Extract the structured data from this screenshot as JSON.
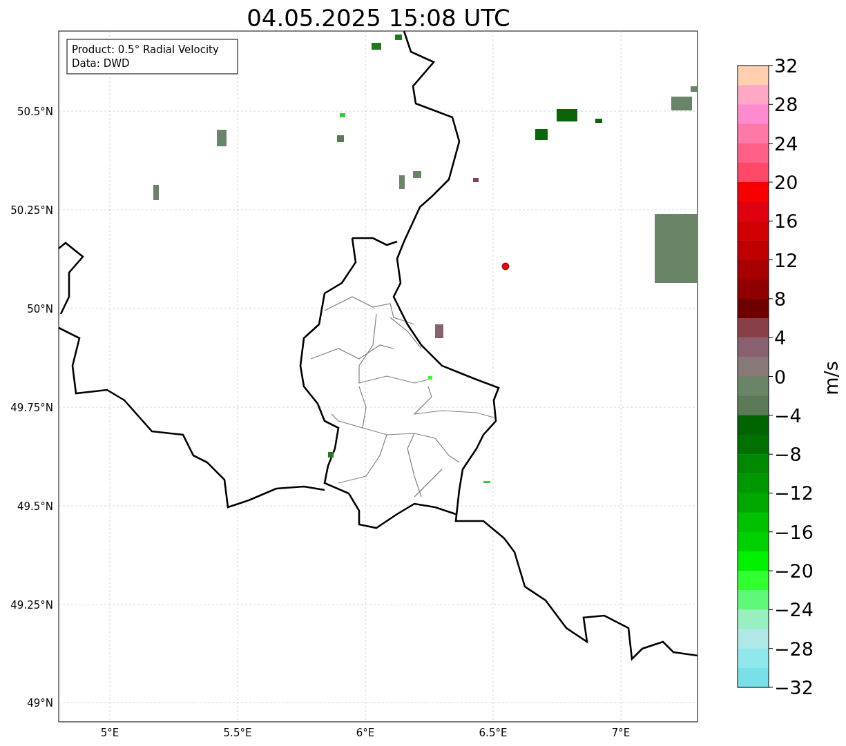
{
  "title": "04.05.2025 15:08 UTC",
  "info_box": [
    "Product: 0.5° Radial Velocity",
    "Data: DWD"
  ],
  "lat_labels": [
    "50.5°N",
    "50.25°N",
    "50°N",
    "49.75°N",
    "49.5°N",
    "49.25°N",
    "49°N"
  ],
  "lon_labels": [
    "5°E",
    "5.5°E",
    "6°E",
    "6.5°E",
    "7°E"
  ],
  "colorbar": {
    "label": "m/s",
    "ticks": [
      "32",
      "28",
      "24",
      "20",
      "16",
      "12",
      "8",
      "4",
      "0",
      "−4",
      "−8",
      "−12",
      "−16",
      "−20",
      "−24",
      "−28",
      "−32"
    ],
    "bands": [
      {
        "color": "#ffcfaf"
      },
      {
        "color": "#ffa8c4"
      },
      {
        "color": "#ff8ad0"
      },
      {
        "color": "#ff78a8"
      },
      {
        "color": "#ff6088"
      },
      {
        "color": "#ff4868"
      },
      {
        "color": "#f80000"
      },
      {
        "color": "#e00010"
      },
      {
        "color": "#d00000"
      },
      {
        "color": "#c00000"
      },
      {
        "color": "#a80000"
      },
      {
        "color": "#900000"
      },
      {
        "color": "#700000"
      },
      {
        "color": "#884048"
      },
      {
        "color": "#886070"
      },
      {
        "color": "#887878"
      },
      {
        "color": "#6a8468"
      },
      {
        "color": "#5a7a58"
      },
      {
        "color": "#006400"
      },
      {
        "color": "#007000"
      },
      {
        "color": "#008800"
      },
      {
        "color": "#009800"
      },
      {
        "color": "#00a800"
      },
      {
        "color": "#00c000"
      },
      {
        "color": "#00d000"
      },
      {
        "color": "#00f000"
      },
      {
        "color": "#30ff30"
      },
      {
        "color": "#60f878"
      },
      {
        "color": "#98f0c0"
      },
      {
        "color": "#b0e8e8"
      },
      {
        "color": "#90e8ec"
      },
      {
        "color": "#78e0e8"
      }
    ]
  }
}
